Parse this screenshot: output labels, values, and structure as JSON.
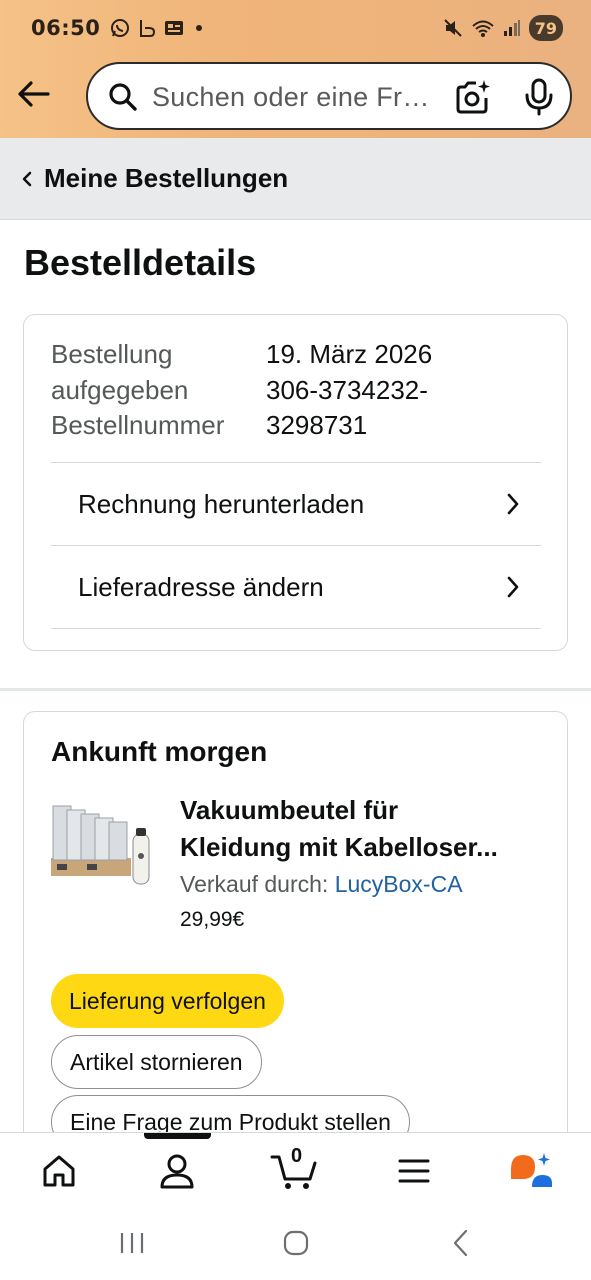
{
  "status_bar": {
    "time": "06:50",
    "battery": "79",
    "icons": [
      "whatsapp-icon",
      "app-icon",
      "gallery-icon",
      "mute-icon",
      "wifi-icon",
      "signal-icon"
    ]
  },
  "header": {
    "search_placeholder": "Suchen oder eine Frage stellen",
    "icons": [
      "back-arrow-icon",
      "search-icon",
      "camera-scan-icon",
      "microphone-icon"
    ]
  },
  "breadcrumb": {
    "label": "Meine Bestellungen"
  },
  "page": {
    "title": "Bestelldetails"
  },
  "order_info": {
    "labels": [
      "Bestellung",
      "aufgegeben",
      "Bestellnummer"
    ],
    "date": "19. März 2026",
    "number_line1": "306-3734232-",
    "number_line2": "3298731",
    "links": [
      {
        "label": "Rechnung herunterladen"
      },
      {
        "label": "Lieferadresse ändern"
      }
    ]
  },
  "shipment": {
    "heading": "Ankunft morgen",
    "product": {
      "title_line1": "Vakuumbeutel für",
      "title_line2": "Kleidung mit Kabelloser...",
      "seller_prefix": "Verkauf durch: ",
      "seller_name": "LucyBox-CA",
      "price": "29,99€"
    },
    "buttons": {
      "track": "Lieferung verfolgen",
      "cancel": "Artikel stornieren",
      "question": "Eine Frage zum Produkt stellen"
    }
  },
  "bottom_nav": {
    "items": [
      "home-icon",
      "account-icon",
      "cart-icon",
      "menu-icon",
      "rufus-ai-icon"
    ],
    "cart_count": "0",
    "active_item": "account"
  },
  "colors": {
    "header_gradient": "#f0b57a",
    "primary_button": "#ffd814",
    "link": "#2162a1",
    "breadcrumb_bg": "#e8eaeb"
  }
}
